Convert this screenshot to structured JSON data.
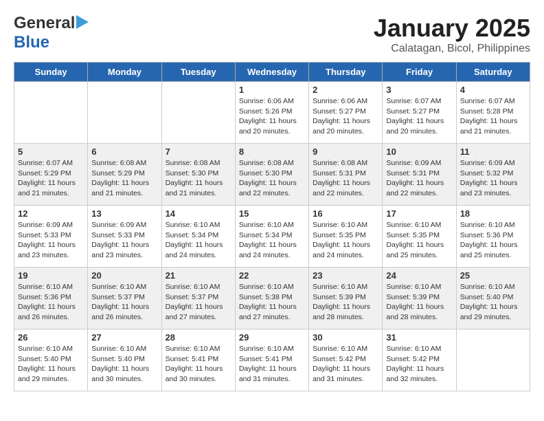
{
  "header": {
    "logo_line1": "General",
    "logo_line2": "Blue",
    "title": "January 2025",
    "subtitle": "Calatagan, Bicol, Philippines"
  },
  "days_of_week": [
    "Sunday",
    "Monday",
    "Tuesday",
    "Wednesday",
    "Thursday",
    "Friday",
    "Saturday"
  ],
  "weeks": [
    [
      {
        "day": "",
        "info": ""
      },
      {
        "day": "",
        "info": ""
      },
      {
        "day": "",
        "info": ""
      },
      {
        "day": "1",
        "info": "Sunrise: 6:06 AM\nSunset: 5:26 PM\nDaylight: 11 hours\nand 20 minutes."
      },
      {
        "day": "2",
        "info": "Sunrise: 6:06 AM\nSunset: 5:27 PM\nDaylight: 11 hours\nand 20 minutes."
      },
      {
        "day": "3",
        "info": "Sunrise: 6:07 AM\nSunset: 5:27 PM\nDaylight: 11 hours\nand 20 minutes."
      },
      {
        "day": "4",
        "info": "Sunrise: 6:07 AM\nSunset: 5:28 PM\nDaylight: 11 hours\nand 21 minutes."
      }
    ],
    [
      {
        "day": "5",
        "info": "Sunrise: 6:07 AM\nSunset: 5:29 PM\nDaylight: 11 hours\nand 21 minutes."
      },
      {
        "day": "6",
        "info": "Sunrise: 6:08 AM\nSunset: 5:29 PM\nDaylight: 11 hours\nand 21 minutes."
      },
      {
        "day": "7",
        "info": "Sunrise: 6:08 AM\nSunset: 5:30 PM\nDaylight: 11 hours\nand 21 minutes."
      },
      {
        "day": "8",
        "info": "Sunrise: 6:08 AM\nSunset: 5:30 PM\nDaylight: 11 hours\nand 22 minutes."
      },
      {
        "day": "9",
        "info": "Sunrise: 6:08 AM\nSunset: 5:31 PM\nDaylight: 11 hours\nand 22 minutes."
      },
      {
        "day": "10",
        "info": "Sunrise: 6:09 AM\nSunset: 5:31 PM\nDaylight: 11 hours\nand 22 minutes."
      },
      {
        "day": "11",
        "info": "Sunrise: 6:09 AM\nSunset: 5:32 PM\nDaylight: 11 hours\nand 23 minutes."
      }
    ],
    [
      {
        "day": "12",
        "info": "Sunrise: 6:09 AM\nSunset: 5:33 PM\nDaylight: 11 hours\nand 23 minutes."
      },
      {
        "day": "13",
        "info": "Sunrise: 6:09 AM\nSunset: 5:33 PM\nDaylight: 11 hours\nand 23 minutes."
      },
      {
        "day": "14",
        "info": "Sunrise: 6:10 AM\nSunset: 5:34 PM\nDaylight: 11 hours\nand 24 minutes."
      },
      {
        "day": "15",
        "info": "Sunrise: 6:10 AM\nSunset: 5:34 PM\nDaylight: 11 hours\nand 24 minutes."
      },
      {
        "day": "16",
        "info": "Sunrise: 6:10 AM\nSunset: 5:35 PM\nDaylight: 11 hours\nand 24 minutes."
      },
      {
        "day": "17",
        "info": "Sunrise: 6:10 AM\nSunset: 5:35 PM\nDaylight: 11 hours\nand 25 minutes."
      },
      {
        "day": "18",
        "info": "Sunrise: 6:10 AM\nSunset: 5:36 PM\nDaylight: 11 hours\nand 25 minutes."
      }
    ],
    [
      {
        "day": "19",
        "info": "Sunrise: 6:10 AM\nSunset: 5:36 PM\nDaylight: 11 hours\nand 26 minutes."
      },
      {
        "day": "20",
        "info": "Sunrise: 6:10 AM\nSunset: 5:37 PM\nDaylight: 11 hours\nand 26 minutes."
      },
      {
        "day": "21",
        "info": "Sunrise: 6:10 AM\nSunset: 5:37 PM\nDaylight: 11 hours\nand 27 minutes."
      },
      {
        "day": "22",
        "info": "Sunrise: 6:10 AM\nSunset: 5:38 PM\nDaylight: 11 hours\nand 27 minutes."
      },
      {
        "day": "23",
        "info": "Sunrise: 6:10 AM\nSunset: 5:39 PM\nDaylight: 11 hours\nand 28 minutes."
      },
      {
        "day": "24",
        "info": "Sunrise: 6:10 AM\nSunset: 5:39 PM\nDaylight: 11 hours\nand 28 minutes."
      },
      {
        "day": "25",
        "info": "Sunrise: 6:10 AM\nSunset: 5:40 PM\nDaylight: 11 hours\nand 29 minutes."
      }
    ],
    [
      {
        "day": "26",
        "info": "Sunrise: 6:10 AM\nSunset: 5:40 PM\nDaylight: 11 hours\nand 29 minutes."
      },
      {
        "day": "27",
        "info": "Sunrise: 6:10 AM\nSunset: 5:40 PM\nDaylight: 11 hours\nand 30 minutes."
      },
      {
        "day": "28",
        "info": "Sunrise: 6:10 AM\nSunset: 5:41 PM\nDaylight: 11 hours\nand 30 minutes."
      },
      {
        "day": "29",
        "info": "Sunrise: 6:10 AM\nSunset: 5:41 PM\nDaylight: 11 hours\nand 31 minutes."
      },
      {
        "day": "30",
        "info": "Sunrise: 6:10 AM\nSunset: 5:42 PM\nDaylight: 11 hours\nand 31 minutes."
      },
      {
        "day": "31",
        "info": "Sunrise: 6:10 AM\nSunset: 5:42 PM\nDaylight: 11 hours\nand 32 minutes."
      },
      {
        "day": "",
        "info": ""
      }
    ]
  ]
}
